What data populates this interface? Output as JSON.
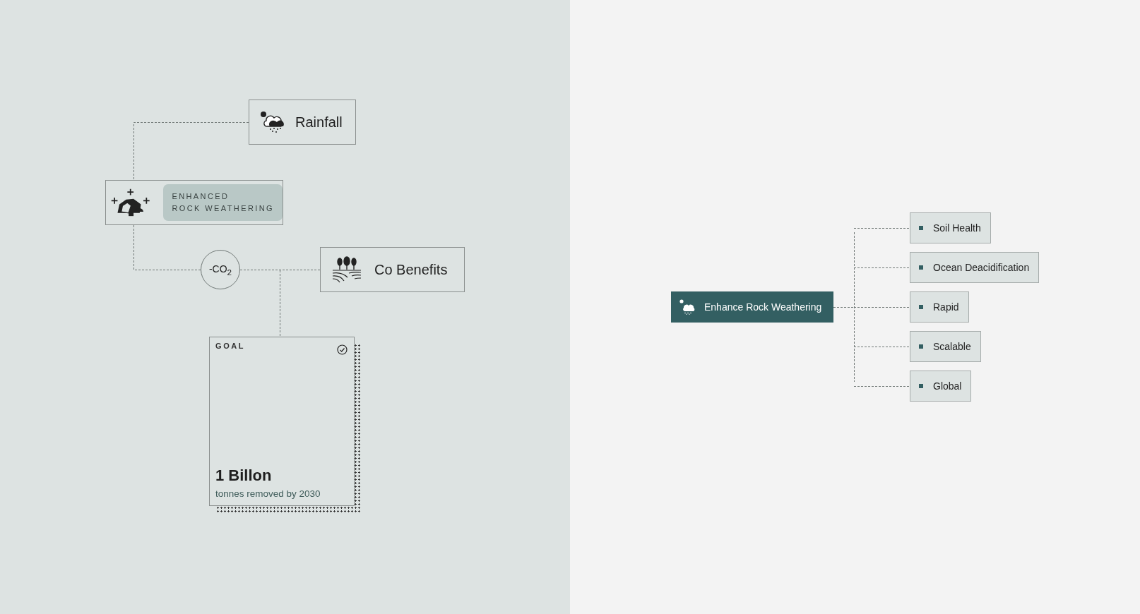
{
  "process_diagram": {
    "rainfall_node": {
      "label": "Rainfall"
    },
    "process_node": {
      "tag_lines": [
        "ENHANCED",
        "ROCK WEATHERING"
      ]
    },
    "co2_node": {
      "label": "-CO$_{2}$"
    },
    "benefits_node": {
      "label": "Co Benefits"
    },
    "goal_card": {
      "label": "GOAL",
      "value": "1 Billon",
      "caption": "tonnes removed by 2030"
    }
  },
  "benefit_tree": {
    "root": {
      "label": "Enhance Rock Weathering"
    },
    "children": [
      {
        "label": "Soil Health"
      },
      {
        "label": "Ocean Deacidification"
      },
      {
        "label": "Rapid"
      },
      {
        "label": "Scalable"
      },
      {
        "label": "Global"
      }
    ]
  }
}
